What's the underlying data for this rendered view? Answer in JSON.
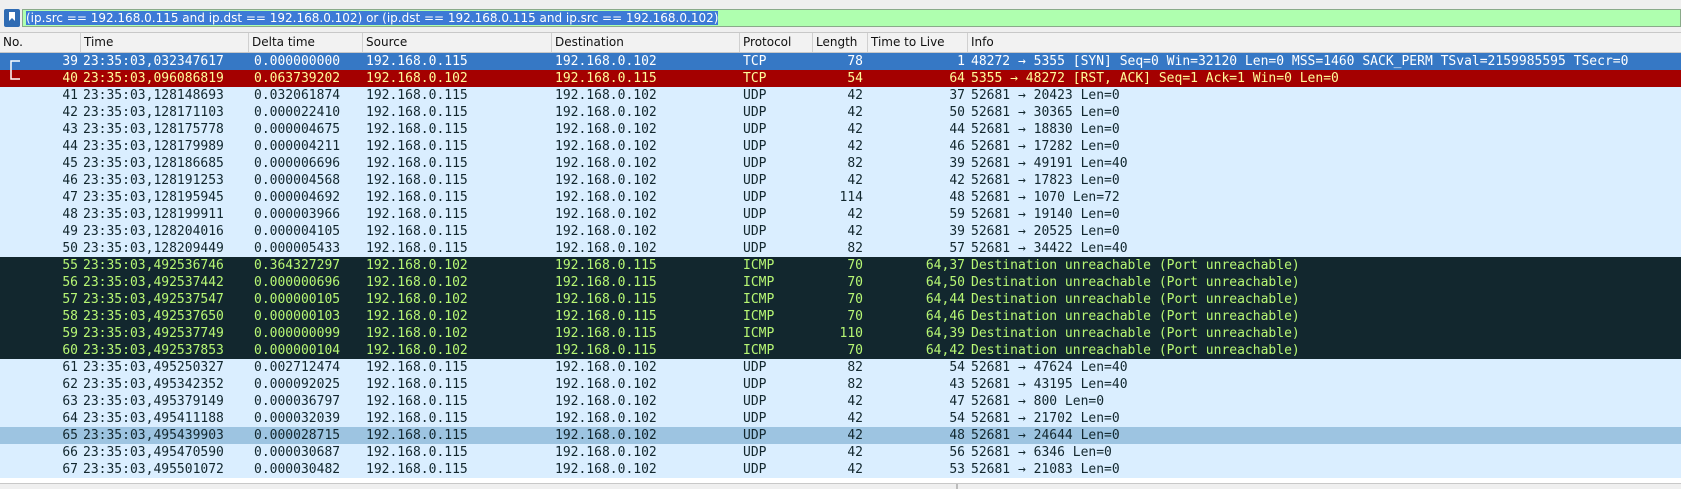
{
  "display_filter": {
    "text": "(ip.src == 192.168.0.115 and ip.dst == 192.168.0.102) or  (ip.dst == 192.168.0.115 and ip.src == 192.168.0.102)"
  },
  "columns": [
    "No.",
    "Time",
    "Delta time",
    "Source",
    "Destination",
    "Protocol",
    "Length",
    "Time to Live",
    "Info"
  ],
  "colors": {
    "udp_bg": "#daeeff",
    "selected_bg": "#3678c5",
    "rst_bg": "#a40000",
    "rst_fg": "#fffc9c",
    "icmp_bg": "#12272e",
    "icmp_fg": "#b7f774",
    "highlight_bg": "#9dc4e1",
    "filter_bg": "#afffaf"
  },
  "packets": [
    {
      "no": "39",
      "time": "23:35:03,032347617",
      "delta": "0.000000000",
      "src": "192.168.0.115",
      "dst": "192.168.0.102",
      "proto": "TCP",
      "len": "78",
      "ttl": "1",
      "info": "48272 → 5355 [SYN] Seq=0 Win=32120 Len=0 MSS=1460 SACK_PERM TSval=2159985595 TSecr=0",
      "style": "tcp-sel"
    },
    {
      "no": "40",
      "time": "23:35:03,096086819",
      "delta": "0.063739202",
      "src": "192.168.0.102",
      "dst": "192.168.0.115",
      "proto": "TCP",
      "len": "54",
      "ttl": "64",
      "info": "5355 → 48272 [RST, ACK] Seq=1 Ack=1 Win=0 Len=0",
      "style": "rst"
    },
    {
      "no": "41",
      "time": "23:35:03,128148693",
      "delta": "0.032061874",
      "src": "192.168.0.115",
      "dst": "192.168.0.102",
      "proto": "UDP",
      "len": "42",
      "ttl": "37",
      "info": "52681 → 20423 Len=0",
      "style": "udp"
    },
    {
      "no": "42",
      "time": "23:35:03,128171103",
      "delta": "0.000022410",
      "src": "192.168.0.115",
      "dst": "192.168.0.102",
      "proto": "UDP",
      "len": "42",
      "ttl": "50",
      "info": "52681 → 30365 Len=0",
      "style": "udp"
    },
    {
      "no": "43",
      "time": "23:35:03,128175778",
      "delta": "0.000004675",
      "src": "192.168.0.115",
      "dst": "192.168.0.102",
      "proto": "UDP",
      "len": "42",
      "ttl": "44",
      "info": "52681 → 18830 Len=0",
      "style": "udp"
    },
    {
      "no": "44",
      "time": "23:35:03,128179989",
      "delta": "0.000004211",
      "src": "192.168.0.115",
      "dst": "192.168.0.102",
      "proto": "UDP",
      "len": "42",
      "ttl": "46",
      "info": "52681 → 17282 Len=0",
      "style": "udp"
    },
    {
      "no": "45",
      "time": "23:35:03,128186685",
      "delta": "0.000006696",
      "src": "192.168.0.115",
      "dst": "192.168.0.102",
      "proto": "UDP",
      "len": "82",
      "ttl": "39",
      "info": "52681 → 49191 Len=40",
      "style": "udp"
    },
    {
      "no": "46",
      "time": "23:35:03,128191253",
      "delta": "0.000004568",
      "src": "192.168.0.115",
      "dst": "192.168.0.102",
      "proto": "UDP",
      "len": "42",
      "ttl": "42",
      "info": "52681 → 17823 Len=0",
      "style": "udp"
    },
    {
      "no": "47",
      "time": "23:35:03,128195945",
      "delta": "0.000004692",
      "src": "192.168.0.115",
      "dst": "192.168.0.102",
      "proto": "UDP",
      "len": "114",
      "ttl": "48",
      "info": "52681 → 1070 Len=72",
      "style": "udp"
    },
    {
      "no": "48",
      "time": "23:35:03,128199911",
      "delta": "0.000003966",
      "src": "192.168.0.115",
      "dst": "192.168.0.102",
      "proto": "UDP",
      "len": "42",
      "ttl": "59",
      "info": "52681 → 19140 Len=0",
      "style": "udp"
    },
    {
      "no": "49",
      "time": "23:35:03,128204016",
      "delta": "0.000004105",
      "src": "192.168.0.115",
      "dst": "192.168.0.102",
      "proto": "UDP",
      "len": "42",
      "ttl": "39",
      "info": "52681 → 20525 Len=0",
      "style": "udp"
    },
    {
      "no": "50",
      "time": "23:35:03,128209449",
      "delta": "0.000005433",
      "src": "192.168.0.115",
      "dst": "192.168.0.102",
      "proto": "UDP",
      "len": "82",
      "ttl": "57",
      "info": "52681 → 34422 Len=40",
      "style": "udp"
    },
    {
      "no": "55",
      "time": "23:35:03,492536746",
      "delta": "0.364327297",
      "src": "192.168.0.102",
      "dst": "192.168.0.115",
      "proto": "ICMP",
      "len": "70",
      "ttl": "64,37",
      "info": "Destination unreachable (Port unreachable)",
      "style": "icmp"
    },
    {
      "no": "56",
      "time": "23:35:03,492537442",
      "delta": "0.000000696",
      "src": "192.168.0.102",
      "dst": "192.168.0.115",
      "proto": "ICMP",
      "len": "70",
      "ttl": "64,50",
      "info": "Destination unreachable (Port unreachable)",
      "style": "icmp"
    },
    {
      "no": "57",
      "time": "23:35:03,492537547",
      "delta": "0.000000105",
      "src": "192.168.0.102",
      "dst": "192.168.0.115",
      "proto": "ICMP",
      "len": "70",
      "ttl": "64,44",
      "info": "Destination unreachable (Port unreachable)",
      "style": "icmp"
    },
    {
      "no": "58",
      "time": "23:35:03,492537650",
      "delta": "0.000000103",
      "src": "192.168.0.102",
      "dst": "192.168.0.115",
      "proto": "ICMP",
      "len": "70",
      "ttl": "64,46",
      "info": "Destination unreachable (Port unreachable)",
      "style": "icmp"
    },
    {
      "no": "59",
      "time": "23:35:03,492537749",
      "delta": "0.000000099",
      "src": "192.168.0.102",
      "dst": "192.168.0.115",
      "proto": "ICMP",
      "len": "110",
      "ttl": "64,39",
      "info": "Destination unreachable (Port unreachable)",
      "style": "icmp"
    },
    {
      "no": "60",
      "time": "23:35:03,492537853",
      "delta": "0.000000104",
      "src": "192.168.0.102",
      "dst": "192.168.0.115",
      "proto": "ICMP",
      "len": "70",
      "ttl": "64,42",
      "info": "Destination unreachable (Port unreachable)",
      "style": "icmp"
    },
    {
      "no": "61",
      "time": "23:35:03,495250327",
      "delta": "0.002712474",
      "src": "192.168.0.115",
      "dst": "192.168.0.102",
      "proto": "UDP",
      "len": "82",
      "ttl": "54",
      "info": "52681 → 47624 Len=40",
      "style": "udp"
    },
    {
      "no": "62",
      "time": "23:35:03,495342352",
      "delta": "0.000092025",
      "src": "192.168.0.115",
      "dst": "192.168.0.102",
      "proto": "UDP",
      "len": "82",
      "ttl": "43",
      "info": "52681 → 43195 Len=40",
      "style": "udp"
    },
    {
      "no": "63",
      "time": "23:35:03,495379149",
      "delta": "0.000036797",
      "src": "192.168.0.115",
      "dst": "192.168.0.102",
      "proto": "UDP",
      "len": "42",
      "ttl": "47",
      "info": "52681 → 800 Len=0",
      "style": "udp"
    },
    {
      "no": "64",
      "time": "23:35:03,495411188",
      "delta": "0.000032039",
      "src": "192.168.0.115",
      "dst": "192.168.0.102",
      "proto": "UDP",
      "len": "42",
      "ttl": "54",
      "info": "52681 → 21702 Len=0",
      "style": "udp"
    },
    {
      "no": "65",
      "time": "23:35:03,495439903",
      "delta": "0.000028715",
      "src": "192.168.0.115",
      "dst": "192.168.0.102",
      "proto": "UDP",
      "len": "42",
      "ttl": "48",
      "info": "52681 → 24644 Len=0",
      "style": "hl"
    },
    {
      "no": "66",
      "time": "23:35:03,495470590",
      "delta": "0.000030687",
      "src": "192.168.0.115",
      "dst": "192.168.0.102",
      "proto": "UDP",
      "len": "42",
      "ttl": "56",
      "info": "52681 → 6346 Len=0",
      "style": "udp"
    },
    {
      "no": "67",
      "time": "23:35:03,495501072",
      "delta": "0.000030482",
      "src": "192.168.0.115",
      "dst": "192.168.0.102",
      "proto": "UDP",
      "len": "42",
      "ttl": "53",
      "info": "52681 → 21083 Len=0",
      "style": "udp"
    }
  ]
}
